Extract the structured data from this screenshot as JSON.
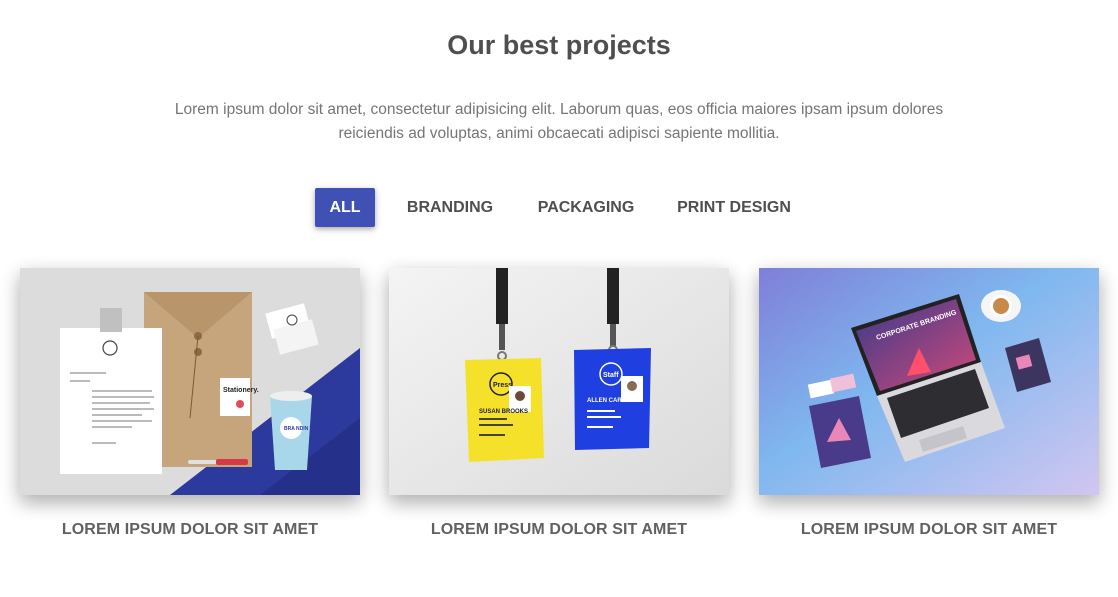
{
  "section": {
    "title": "Our best projects",
    "description_line1": "Lorem ipsum dolor sit amet, consectetur adipisicing elit. Laborum quas, eos officia maiores ipsam ipsum dolores",
    "description_line2": "reiciendis ad voluptas, animi obcaecati adipisci sapiente mollitia."
  },
  "filters": [
    {
      "label": "ALL",
      "active": true
    },
    {
      "label": "BRANDING",
      "active": false
    },
    {
      "label": "PACKAGING",
      "active": false
    },
    {
      "label": "PRINT DESIGN",
      "active": false
    }
  ],
  "colors": {
    "accent": "#3f51b5",
    "title": "#4f4f4f",
    "text": "#757575"
  },
  "projects": [
    {
      "caption": "LOREM IPSUM DOLOR SIT AMET",
      "image": "stationery-mockup",
      "image_text": {
        "tag": "Stationery.",
        "cup": "BRA NDIN UTS",
        "logo": "BRA NDIN"
      }
    },
    {
      "caption": "LOREM IPSUM DOLOR SIT AMET",
      "image": "id-badges-mockup",
      "image_text": {
        "badge1_role": "Press",
        "badge1_name": "SUSAN BROOKS",
        "badge2_role": "Staff",
        "badge2_name": "ALLEN CARTER"
      }
    },
    {
      "caption": "LOREM IPSUM DOLOR SIT AMET",
      "image": "laptop-branding-mockup",
      "image_text": {
        "screen": "CORPORATE BRANDING"
      }
    }
  ]
}
